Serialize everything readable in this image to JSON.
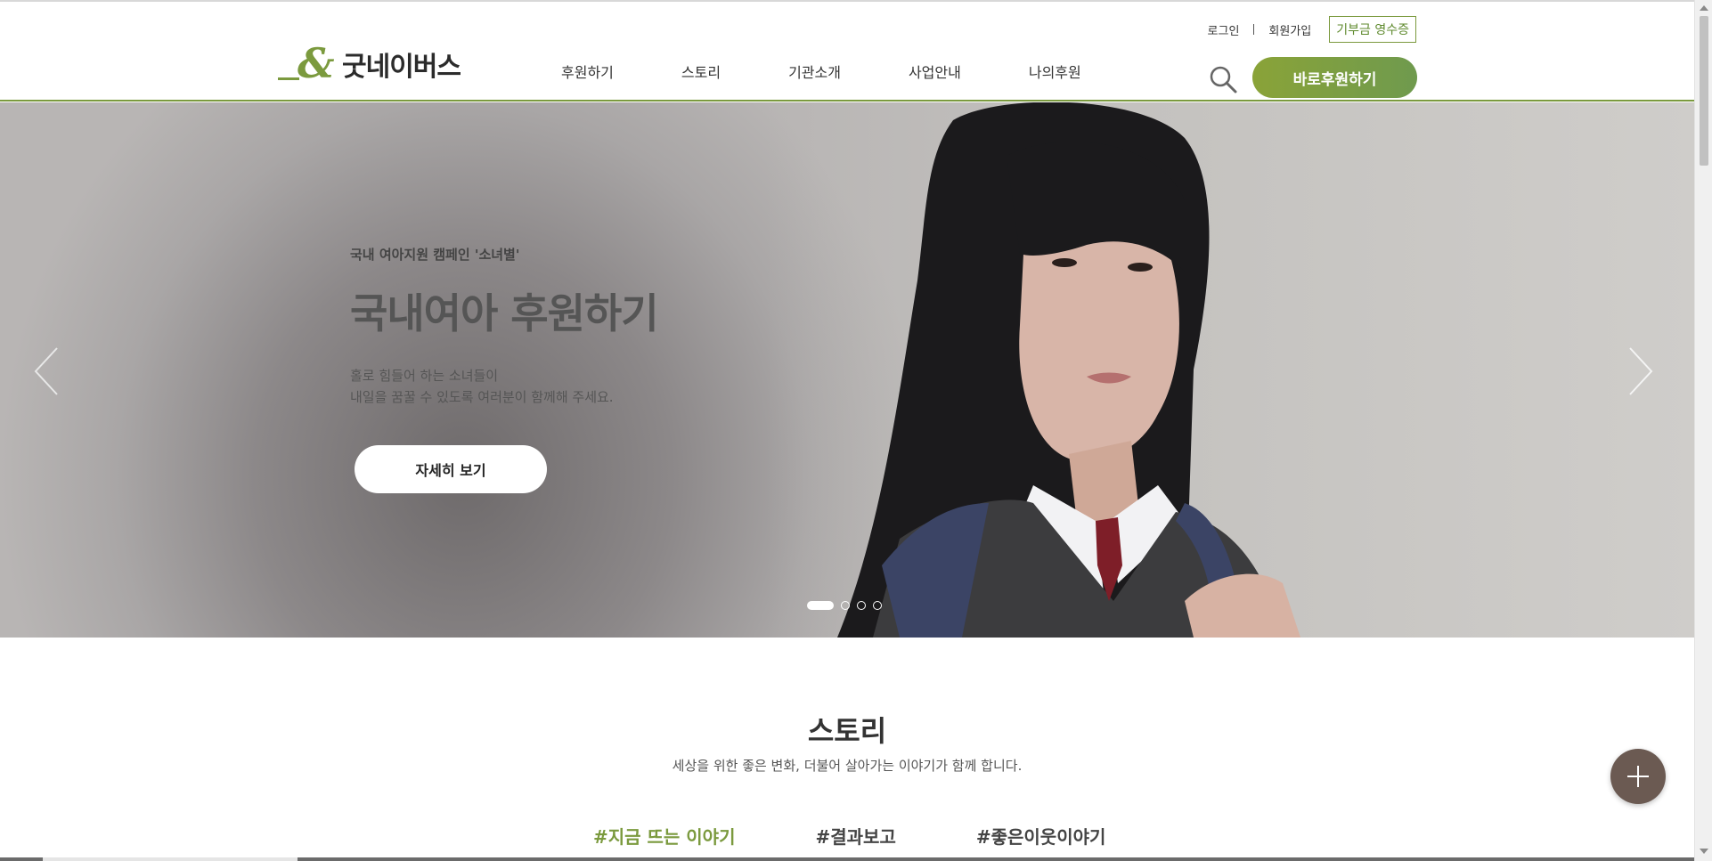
{
  "header": {
    "logo_text": "굿네이버스",
    "util": {
      "login": "로그인",
      "signup": "회원가입",
      "receipt": "기부금 영수증"
    },
    "nav": [
      "후원하기",
      "스토리",
      "기관소개",
      "사업안내",
      "나의후원"
    ],
    "donate_button": "바로후원하기",
    "accent_color": "#7b9a3e"
  },
  "hero": {
    "eyebrow": "국내 여아지원 캠페인 '소녀별'",
    "title": "국내여아 후원하기",
    "desc_line1": "홀로 힘들어 하는 소녀들이",
    "desc_line2": "내일을 꿈꿀 수 있도록 여러분이 함께해 주세요.",
    "more_button": "자세히 보기",
    "slide_count": 4,
    "active_slide": 1
  },
  "story": {
    "title": "스토리",
    "subtitle": "세상을 위한 좋은 변화, 더불어 살아가는 이야기가 함께 합니다.",
    "tabs": [
      "#지금 뜨는 이야기",
      "#결과보고",
      "#좋은이웃이야기"
    ],
    "active_tab": 0
  },
  "icons": {
    "search": "search-icon",
    "prev": "chevron-left-icon",
    "next": "chevron-right-icon",
    "fab": "plus-icon"
  }
}
